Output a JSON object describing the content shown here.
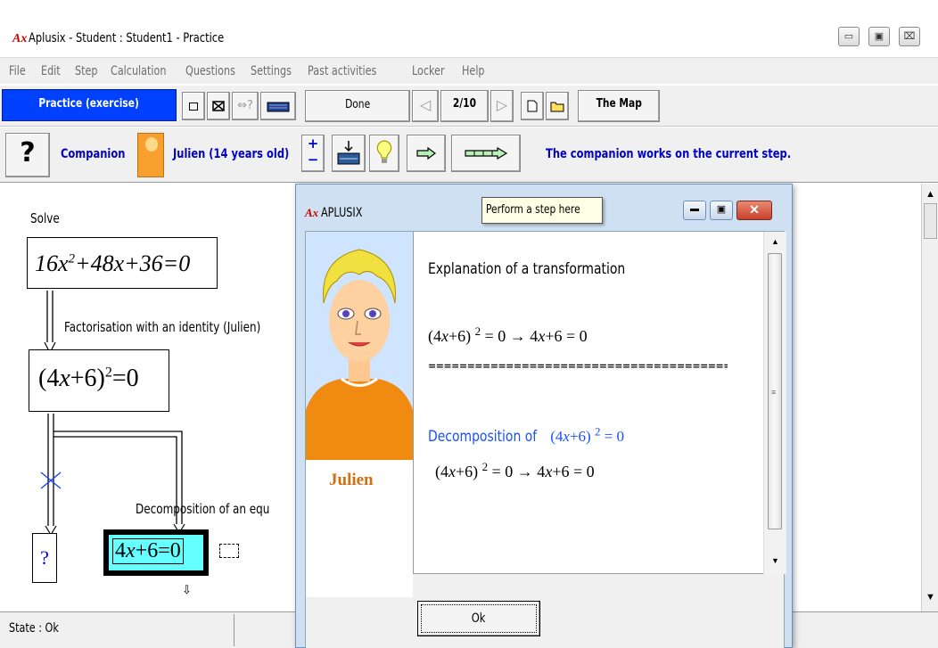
{
  "window": {
    "logo": "Ax",
    "title": "Aplusix - Student : Student1 - Practice",
    "minimize_glyph": "▭",
    "maximize_glyph": "▣",
    "close_glyph": "⌧"
  },
  "menu": {
    "items": [
      "File",
      "Edit",
      "Step",
      "Calculation",
      "Questions",
      "Settings",
      "Past activities",
      "Locker",
      "Help"
    ]
  },
  "toolbar1": {
    "mode_label": "Practice (exercise)",
    "done_label": "Done",
    "page_indicator": "2/10",
    "map_label": "The Map"
  },
  "toolbar2": {
    "help_glyph": "?",
    "companion_label": "Companion",
    "companion_name": "Julien (14 years old)",
    "status_message": "The companion works on the current step."
  },
  "workarea": {
    "solve_label": "Solve",
    "eq1": "16x²+48x+36=0",
    "rule1": "Factorisation with an identity (Julien)",
    "eq2": "(4x+6)²=0",
    "rule2": "Decomposition of an equ",
    "unknown_box": "?",
    "eq3": "4x+6=0"
  },
  "tooltip": {
    "text": "Perform a step here"
  },
  "dialog": {
    "logo": "Ax",
    "title": "APLUSIX",
    "companion_caption": "Julien",
    "heading": "Explanation of a transformation",
    "line1": "(4x+6)² = 0 → 4x+6 = 0",
    "separator": "=======================================",
    "decomp_label": "Decomposition of  (4x+6)² = 0",
    "line2": "(4x+6)² = 0 → 4x+6 = 0",
    "ok_label": "Ok"
  },
  "statusbar": {
    "state": "State : Ok"
  },
  "colors": {
    "accent_blue": "#0000ff",
    "dark_blue_text": "#0000c8",
    "eq_highlight": "#6ff",
    "close_red": "#c8402a"
  }
}
